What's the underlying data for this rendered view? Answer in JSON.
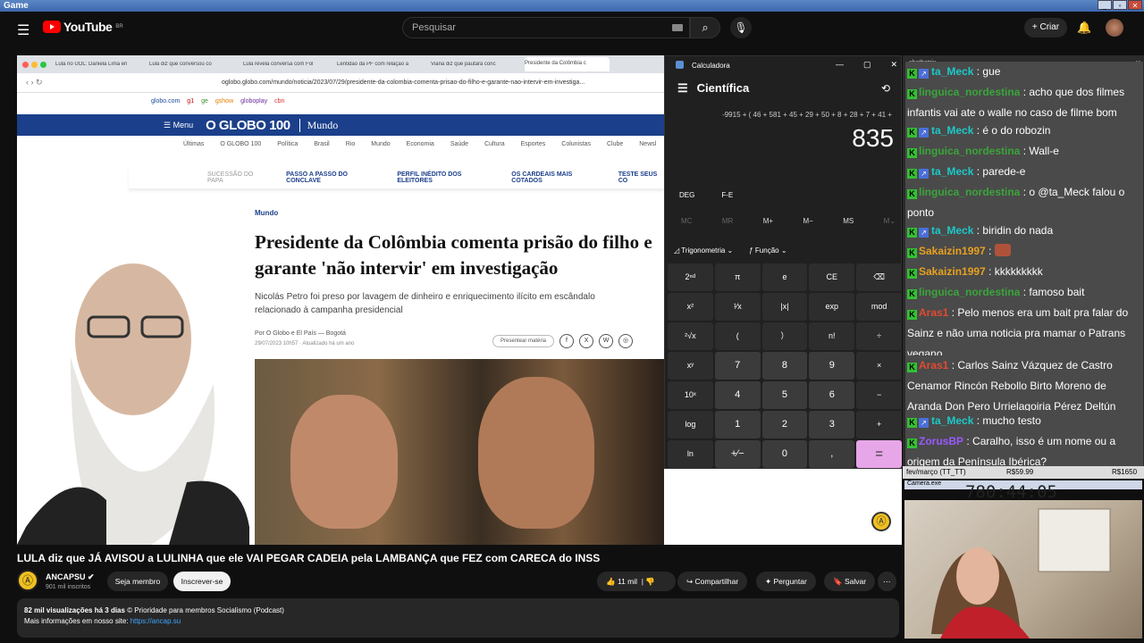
{
  "obs": {
    "title": "Game"
  },
  "youtube": {
    "logo": "YouTube",
    "region": "BR",
    "search_placeholder": "Pesquisar",
    "create": "Criar"
  },
  "browser": {
    "tabs": [
      "Lula no UOL: Daniela Lima en",
      "Lula diz que conversou co",
      "Lula revela conversa com Fol",
      "Lentidão da PF com relação a",
      "Viana diz que pautará conc",
      "Presidente da Colômbia c"
    ],
    "url": "oglobo.globo.com/mundo/noticia/2023/07/29/presidente-da-colombia-comenta-prisao-do-filho-e-garante-nao-intervir-em-investiga...",
    "bookmarks": [
      "globo.com",
      "g1",
      "ge",
      "gshow",
      "globoplay",
      "cbn"
    ]
  },
  "article": {
    "menu": "Menu",
    "brand": "O GLOBO 100",
    "section": "Mundo",
    "nav": [
      "Últimas",
      "O GLOBO 100",
      "Política",
      "Brasil",
      "Rio",
      "Mundo",
      "Economia",
      "Saúde",
      "Cultura",
      "Esportes",
      "Colunistas",
      "Clube",
      "Newsl"
    ],
    "subnav": [
      "SUCESSÃO DO PAPA",
      "PASSO A PASSO DO CONCLAVE",
      "PERFIL INÉDITO DOS ELEITORES",
      "OS CARDEAIS MAIS COTADOS",
      "TESTE SEUS CO"
    ],
    "kicker": "Mundo",
    "headline": "Presidente da Colômbia comenta prisão do filho e garante 'não intervir' em investigação",
    "lede": "Nicolás Petro foi preso por lavagem de dinheiro e enriquecimento ilícito em escândalo relacionado à campanha presidencial",
    "byline": "Por O Globo e El País — Bogotá",
    "date": "29/07/2023 10h57 · Atualizado há um ano",
    "share": "Presentear matéria"
  },
  "calculator": {
    "title": "Calculadora",
    "mode": "Científica",
    "expression": "-9915 + ( 46 + 581 + 45 + 29 + 50 + 8 + 28 + 7 + 41 +",
    "result": "835",
    "deg": "DEG",
    "fe": "F-E",
    "memory": [
      "MC",
      "MR",
      "M+",
      "M−",
      "MS",
      "M⌄"
    ],
    "trig": "Trigonometria",
    "func": "Função",
    "keys": [
      "2ⁿᵈ",
      "π",
      "e",
      "CE",
      "⌫",
      "x²",
      "¹⁄x",
      "|x|",
      "exp",
      "mod",
      "²√x",
      "(",
      "）",
      "n!",
      "÷",
      "xʸ",
      "7",
      "8",
      "9",
      "×",
      "10ˣ",
      "4",
      "5",
      "6",
      "−",
      "log",
      "1",
      "2",
      "3",
      "+",
      "ln",
      "+⁄−",
      "0",
      ",",
      "="
    ]
  },
  "video": {
    "title": "LULA diz que JÁ AVISOU a LULINHA que ele VAI PEGAR CADEIA pela LAMBANÇA que FEZ com CARECA do INSS",
    "channel": "ANCAPSU",
    "subs": "901 mil inscritos",
    "member": "Seja membro",
    "subscribe": "Inscrever-se",
    "likes": "11 mil",
    "share": "Compartilhar",
    "ask": "Perguntar",
    "save": "Salvar",
    "views": "82 mil visualizações  há 3 dias",
    "tags": "© Prioridade para membros  Socialismo (Podcast)",
    "more": "Mais informações em nosso site:",
    "link": "https://ancap.su"
  },
  "chat": {
    "source": "chatbotrix",
    "messages": [
      {
        "user": "ta_Meck",
        "text": "gue",
        "color": "c"
      },
      {
        "user": "linguica_nordestina",
        "text": "acho que dos filmes infantis vai ate o walle no caso de filme bom",
        "color": "g"
      },
      {
        "user": "ta_Meck",
        "text": "é o do robozin",
        "color": "c"
      },
      {
        "user": "linguica_nordestina",
        "text": "Wall-e",
        "color": "g"
      },
      {
        "user": "ta_Meck",
        "text": "parede-e",
        "color": "c"
      },
      {
        "user": "linguica_nordestina",
        "text": "o @ta_Meck falou o ponto",
        "color": "g"
      },
      {
        "user": "ta_Meck",
        "text": "biridin do nada",
        "color": "c"
      },
      {
        "user": "Sakaizin1997",
        "text": "",
        "color": "o"
      },
      {
        "user": "Sakaizin1997",
        "text": "kkkkkkkkk",
        "color": "o"
      },
      {
        "user": "linguica_nordestina",
        "text": "famoso bait",
        "color": "g"
      },
      {
        "user": "Aras1",
        "text": "Pelo menos era um bait pra falar do Sainz e não uma noticia pra mamar o Patrans vegano",
        "color": "r"
      },
      {
        "user": "Aras1",
        "text": "Carlos Sainz Vázquez de Castro Cenamor Rincón Rebollo Birto Moreno de Aranda Don Pero Urrielagoiria Pérez Deltún",
        "color": "r"
      },
      {
        "user": "ta_Meck",
        "text": "mucho testo",
        "color": "c"
      },
      {
        "user": "ZorusBP",
        "text": "Caralho, isso é um nome ou a origem da Península Ibérica?",
        "color": "p"
      }
    ]
  },
  "cam": {
    "month": "fev/março (TT_TT)",
    "mid": "R$59.99",
    "right": "R$1650",
    "label": "Camera.exe",
    "timer": "780:44:05"
  }
}
